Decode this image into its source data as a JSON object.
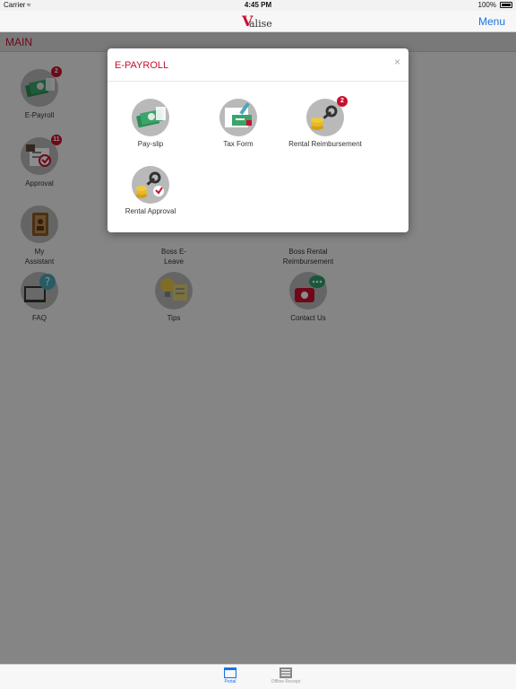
{
  "status_bar": {
    "carrier": "Carrier",
    "time": "4:45 PM",
    "battery": "100%"
  },
  "nav_bar": {
    "logo_text": "alise",
    "menu_label": "Menu"
  },
  "section": {
    "title": "MAIN"
  },
  "grid": [
    {
      "label": "E-Payroll",
      "badge": "2"
    },
    {
      "label": "Approval",
      "badge": "11"
    },
    {
      "label": "My\nAssistant"
    },
    {
      "label": "Boss E-\nLeave"
    },
    {
      "label": "Boss Rental\nReimbursement"
    },
    {
      "label": "FAQ"
    },
    {
      "label": "Tips"
    },
    {
      "label": "Contact Us"
    }
  ],
  "modal": {
    "title": "E-PAYROLL",
    "close": "×",
    "items": [
      {
        "label": "Pay-slip"
      },
      {
        "label": "Tax Form"
      },
      {
        "label": "Rental Reimbursement",
        "badge": "2"
      },
      {
        "label": "Rental Approval"
      }
    ]
  },
  "tab_bar": {
    "tabs": [
      {
        "label": "Portal"
      },
      {
        "label": "Offline Receipt"
      }
    ]
  },
  "colors": {
    "accent": "#c8102e",
    "link": "#1a73e8",
    "overlay": "rgba(0,0,0,0.45)"
  }
}
